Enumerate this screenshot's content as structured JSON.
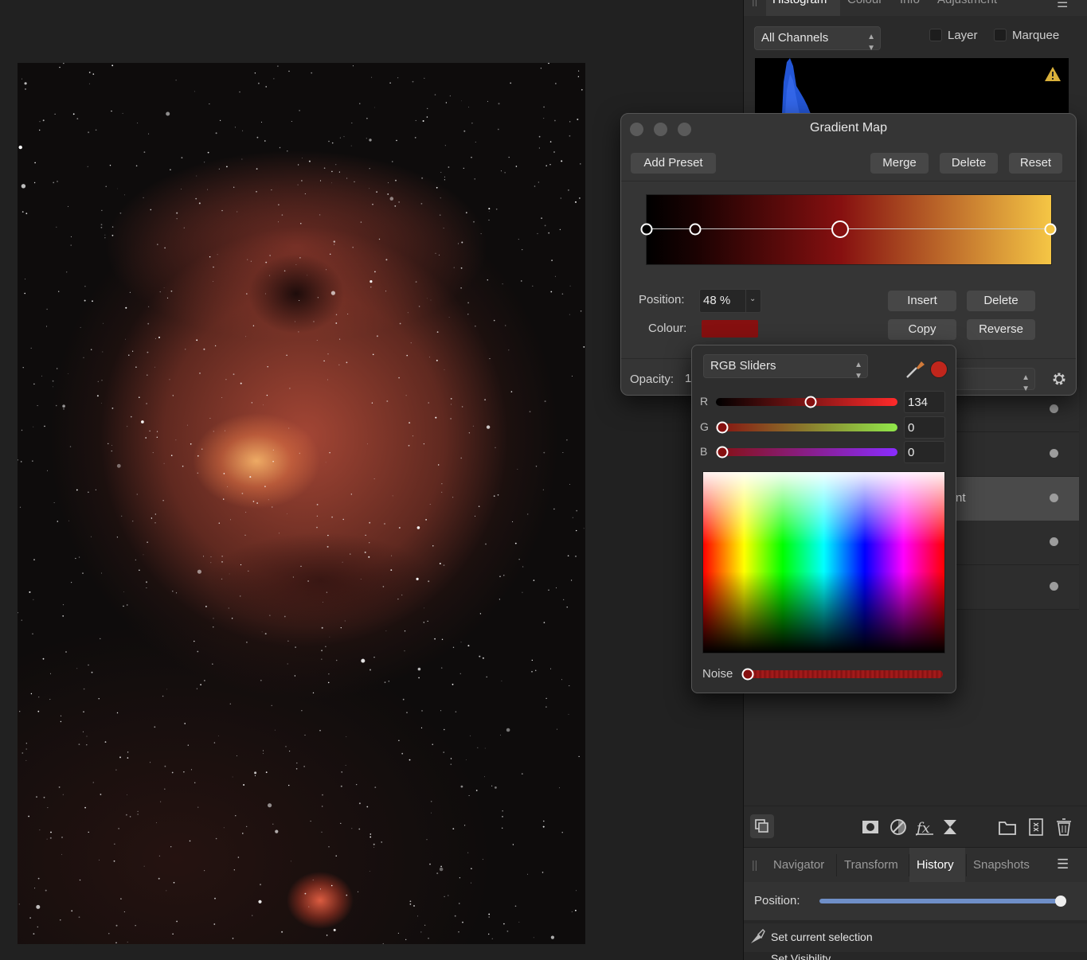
{
  "histogram_panel": {
    "tabs": [
      "Histogram",
      "Colour",
      "Info",
      "Adjustment"
    ],
    "channel_select": "All Channels",
    "layer_label": "Layer",
    "marquee_label": "Marquee",
    "warning_icon": "warning-icon"
  },
  "gradient_map": {
    "title": "Gradient Map",
    "buttons": {
      "add_preset": "Add Preset",
      "merge": "Merge",
      "delete": "Delete",
      "reset": "Reset"
    },
    "gradient_colors": [
      "#000000",
      "#1a0202",
      "#861010",
      "#f5c645"
    ],
    "stop_positions": [
      0,
      0.12,
      0.48,
      1.0
    ],
    "selected_stop": 2,
    "position_label": "Position:",
    "position_value": "48 %",
    "colour_label": "Colour:",
    "colour_swatch": "#861010",
    "insert": "Insert",
    "delete_stop": "Delete",
    "copy": "Copy",
    "reverse": "Reverse",
    "opacity_label": "Opacity:",
    "opacity_value": "1"
  },
  "colour_popup": {
    "mode": "RGB Sliders",
    "current_colour": "#c0261c",
    "r_label": "R",
    "r_value": "134",
    "r_fraction": 0.525,
    "g_label": "G",
    "g_value": "0",
    "g_fraction": 0,
    "b_label": "B",
    "b_value": "0",
    "b_fraction": 0,
    "noise_label": "Noise",
    "noise_fraction": 0
  },
  "layers_panel": {
    "partial_label": "nt"
  },
  "bottom_panel": {
    "tabs": [
      "Navigator",
      "Transform",
      "History",
      "Snapshots"
    ],
    "active_tab": "History",
    "position_label": "Position:",
    "position_fraction": 1.0,
    "history_items": [
      "Set current selection",
      "Set Visibility"
    ]
  }
}
